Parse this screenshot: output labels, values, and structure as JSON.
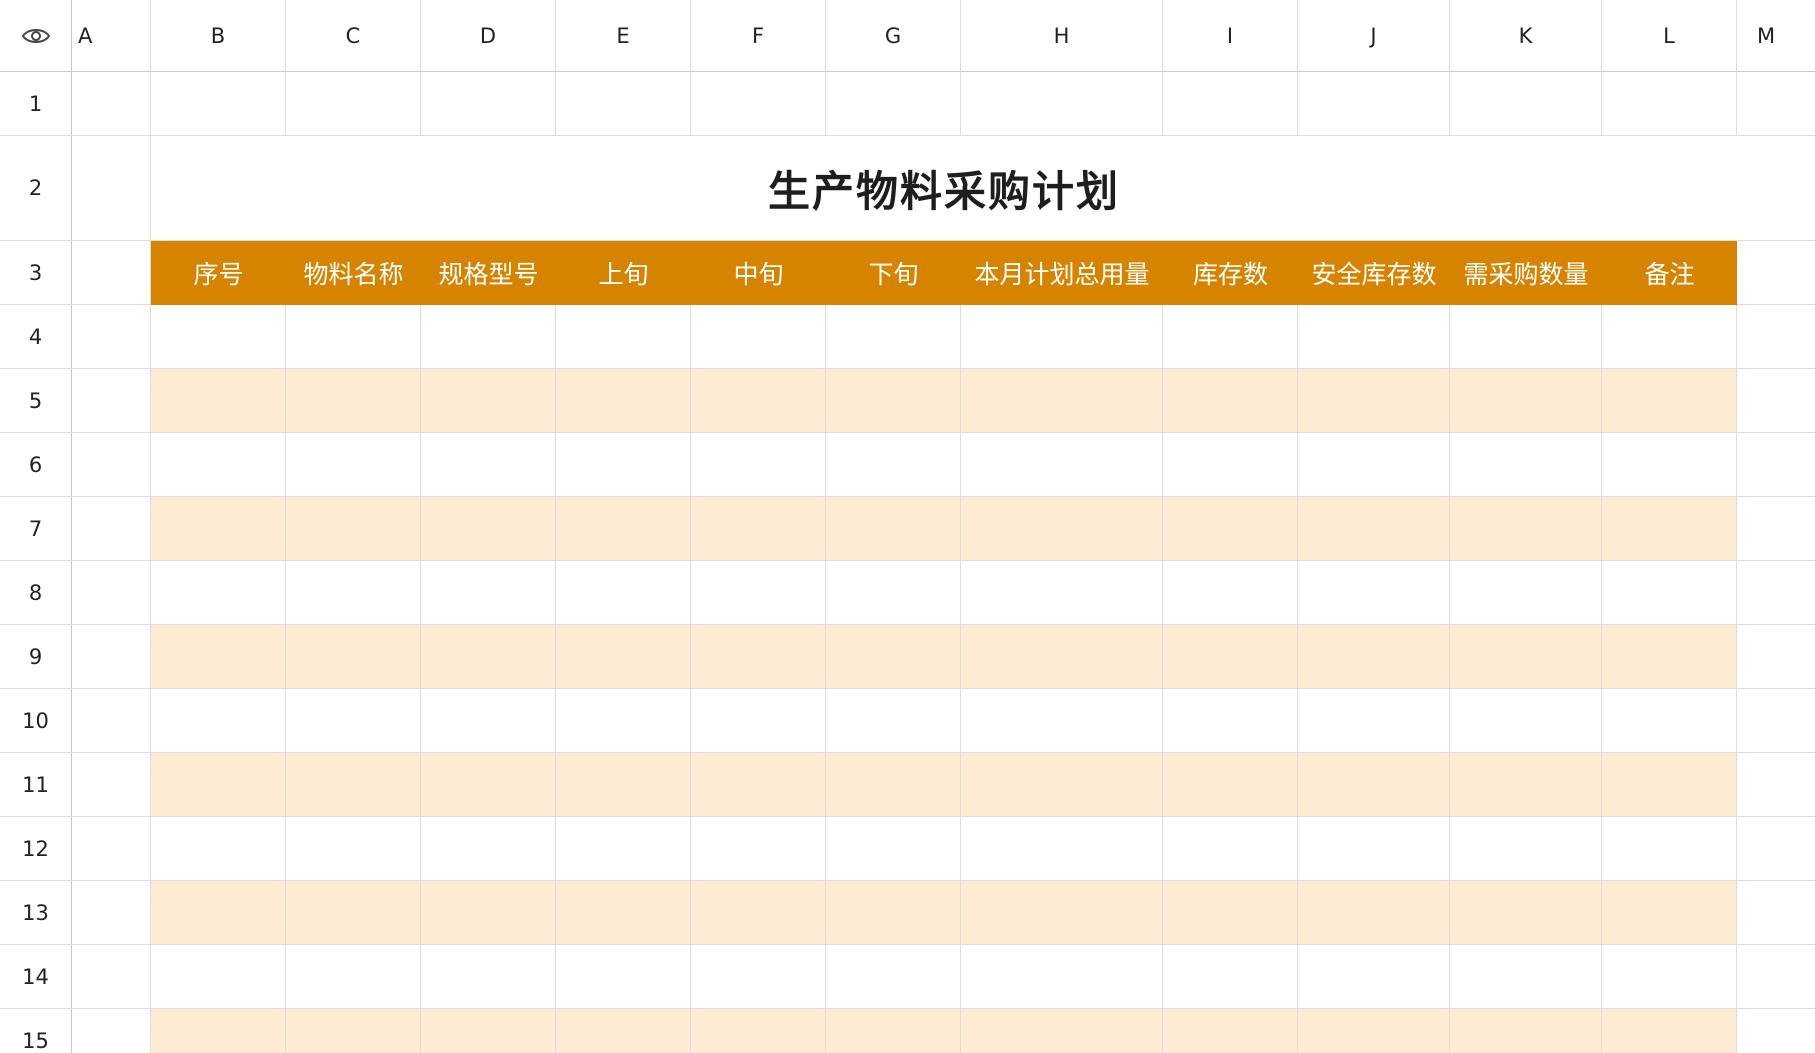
{
  "columns": [
    "A",
    "B",
    "C",
    "D",
    "E",
    "F",
    "G",
    "H",
    "I",
    "J",
    "K",
    "L",
    "M"
  ],
  "rows": [
    "1",
    "2",
    "3",
    "4",
    "5",
    "6",
    "7",
    "8",
    "9",
    "10",
    "11",
    "12",
    "13",
    "14",
    "15"
  ],
  "title": "生产物料采购计划",
  "table_headers": [
    "序号",
    "物料名称",
    "规格型号",
    "上旬",
    "中旬",
    "下旬",
    "本月计划总用量",
    "库存数",
    "安全库存数",
    "需采购数量",
    "备注"
  ],
  "colors": {
    "header_fill": "#d68300",
    "stripe_fill": "#fdebd3",
    "grid_line": "#dcdcdc"
  },
  "corner_icon": "eye-icon"
}
